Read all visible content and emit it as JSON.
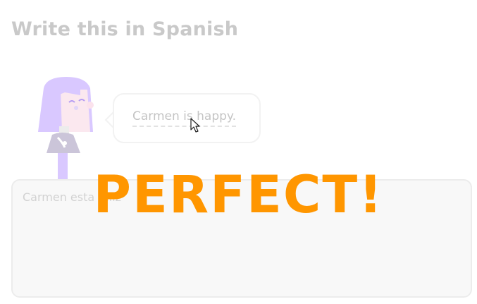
{
  "header": {
    "title": "Write this in Spanish"
  },
  "prompt": {
    "sentence": "Carmen is happy."
  },
  "answer": {
    "value": "Carmen esta feliz"
  },
  "feedback": {
    "message": "PERFECT!"
  },
  "colors": {
    "title": "#c9c9c9",
    "feedback_accent": "#ff9600",
    "character_hair": "#d9c8ff",
    "answer_background": "#f8f8f8"
  },
  "icons": {
    "character": "character-illustration",
    "cursor": "mouse-pointer-icon"
  }
}
